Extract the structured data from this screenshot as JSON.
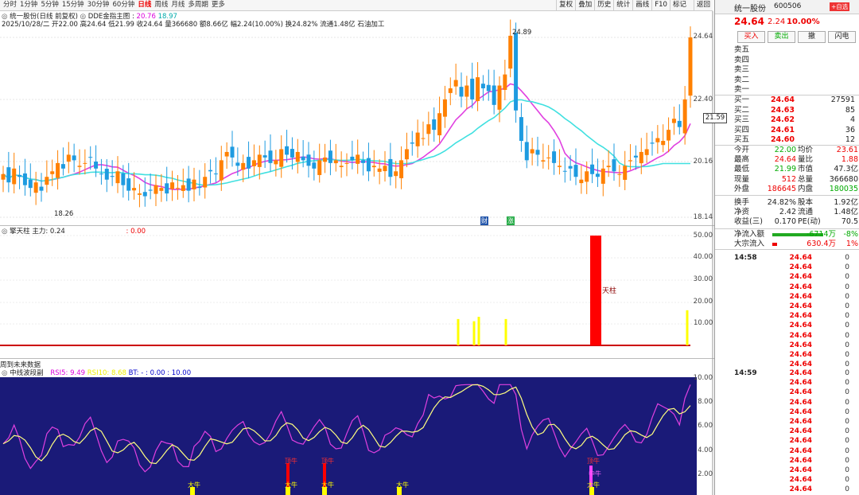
{
  "top_bar": {
    "periods": [
      "分时",
      "1分钟",
      "5分钟",
      "15分钟",
      "30分钟",
      "60分钟",
      "日线",
      "周线",
      "月线",
      "多周期",
      "更多"
    ],
    "active_period": "日线",
    "tools": [
      "复权",
      "叠加",
      "历史",
      "统计",
      "画线",
      "F10",
      "标记"
    ],
    "back_label": "返回"
  },
  "chart_header": {
    "title": "统一股份(日线 前复权)",
    "indicator": "DDE金指主图 :",
    "ind_v1": "20.76",
    "ind_v2": "18.97",
    "line2": "2025/10/28/二 开22.00 高24.64 低21.99 收24.64 量366680 额8.66亿 幅2.24(10.00%) 换24.82% 流通1.48亿 石油加工"
  },
  "price_scale": [
    "24.64",
    "22.40",
    "20.16",
    "18.14"
  ],
  "price_tag": "21.59",
  "annotations": {
    "high": "24.89",
    "low": "18.26",
    "marker1": "财",
    "marker2": "涨"
  },
  "panel2": {
    "title": "擎天柱",
    "main_label": "主力: 0.24",
    "value": ": 0.00",
    "scale": [
      "50.00",
      "40.00",
      "30.00",
      "20.00",
      "10.00"
    ],
    "bar_label": "天柱",
    "note": "周到未来数据"
  },
  "panel3": {
    "title": "中线波段副",
    "rsi_label": "RSI5: 9.49",
    "rsi2_label": "RSI10: 8.68",
    "bt_label": "BT: - : 0.00 : 10.00",
    "scale": [
      "10.00",
      "8.00",
      "6.00",
      "4.00",
      "2.00"
    ],
    "signals": {
      "big_cow": "大牛",
      "mid_cow": "中牛",
      "top": "顶牛"
    }
  },
  "right_panel": {
    "stock_name": "统一股份",
    "stock_code": "600506",
    "watch_label": "+自选",
    "price": "24.64",
    "change": "2.24",
    "change_pct": "10.00%",
    "buttons": [
      "买入",
      "卖出",
      "撤",
      "闪电"
    ],
    "asks": [
      {
        "label": "卖五",
        "price": "",
        "vol": ""
      },
      {
        "label": "卖四",
        "price": "",
        "vol": ""
      },
      {
        "label": "卖三",
        "price": "",
        "vol": ""
      },
      {
        "label": "卖二",
        "price": "",
        "vol": ""
      },
      {
        "label": "卖一",
        "price": "",
        "vol": ""
      }
    ],
    "bids": [
      {
        "label": "买一",
        "price": "24.64",
        "vol": "27591"
      },
      {
        "label": "买二",
        "price": "24.63",
        "vol": "85"
      },
      {
        "label": "买三",
        "price": "24.62",
        "vol": "4"
      },
      {
        "label": "买四",
        "price": "24.61",
        "vol": "36"
      },
      {
        "label": "买五",
        "price": "24.60",
        "vol": "12"
      }
    ],
    "stats": [
      {
        "l1": "今开",
        "v1": "22.00",
        "l2": "均价",
        "v2": "23.61",
        "c1": "green",
        "c2": "red"
      },
      {
        "l1": "最高",
        "v1": "24.64",
        "l2": "量比",
        "v2": "1.88",
        "c1": "red",
        "c2": "red"
      },
      {
        "l1": "最低",
        "v1": "21.99",
        "l2": "市值",
        "v2": "47.3亿",
        "c1": "green",
        "c2": "dark"
      },
      {
        "l1": "现量",
        "v1": "512",
        "l2": "总量",
        "v2": "366680",
        "c1": "red",
        "c2": "dark"
      },
      {
        "l1": "外盘",
        "v1": "186645",
        "l2": "内盘",
        "v2": "180035",
        "c1": "red",
        "c2": "green"
      },
      {
        "l1": "换手",
        "v1": "24.82%",
        "l2": "股本",
        "v2": "1.92亿",
        "c1": "dark",
        "c2": "dark"
      },
      {
        "l1": "净资",
        "v1": "2.42",
        "l2": "流通",
        "v2": "1.48亿",
        "c1": "dark",
        "c2": "dark"
      },
      {
        "l1": "收益(三)",
        "v1": "0.170",
        "l2": "PE(动)",
        "v2": "70.5",
        "c1": "dark",
        "c2": "dark"
      }
    ],
    "flow": [
      {
        "label": "净流入额",
        "value": "-6714万",
        "pct": "-8%"
      },
      {
        "label": "大宗流入",
        "value": "630.4万",
        "pct": "1%"
      }
    ],
    "time1": "14:58",
    "time2": "14:59",
    "tick_price": "24.64",
    "tick_zero": "0"
  },
  "colors": {
    "up": "#ff0000",
    "down": "#00a0e0",
    "ma1": "#e040e0",
    "ma2": "#40e0e0",
    "panel_bg": "#1a1a78"
  }
}
